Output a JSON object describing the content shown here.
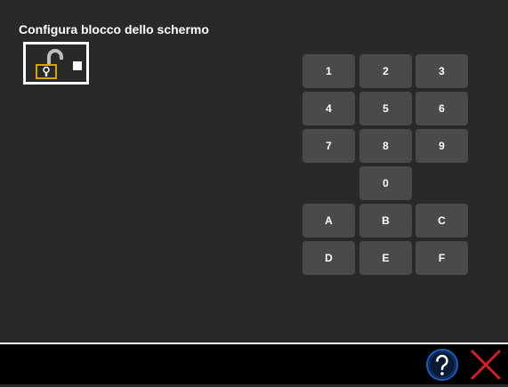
{
  "window": {
    "title": "Configura blocco dello schermo"
  },
  "lock": {
    "icon": "lock-open-icon",
    "checked": false
  },
  "keypad": {
    "keys": [
      "1",
      "2",
      "3",
      "4",
      "5",
      "6",
      "7",
      "8",
      "9",
      "0",
      "A",
      "B",
      "C",
      "D",
      "E",
      "F"
    ]
  },
  "footer": {
    "help_icon": "help-icon",
    "close_icon": "close-icon"
  },
  "colors": {
    "background": "#292929",
    "key": "#4a4a4a",
    "lock_gold": "#d6a300",
    "help_blue": "#1a5fbf",
    "close_red": "#d62020"
  }
}
